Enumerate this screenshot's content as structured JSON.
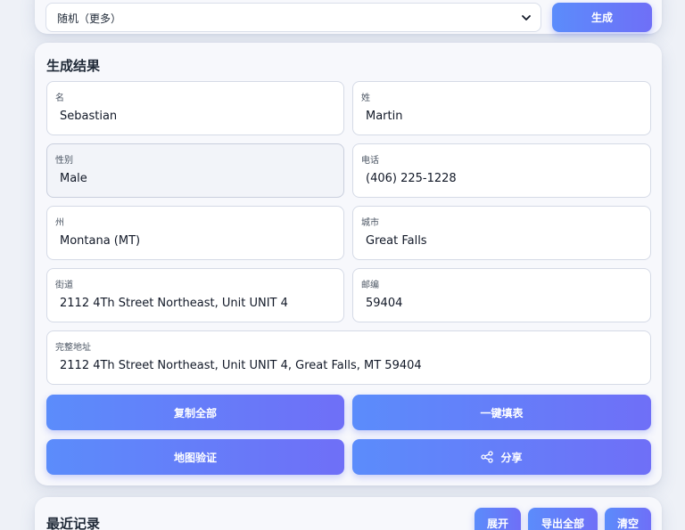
{
  "generator": {
    "select_value": "随机（更多）",
    "generate_label": "生成"
  },
  "result": {
    "title": "生成结果",
    "fields": {
      "first_name": {
        "label": "名",
        "value": "Sebastian"
      },
      "last_name": {
        "label": "姓",
        "value": "Martin"
      },
      "gender": {
        "label": "性别",
        "value": "Male"
      },
      "phone": {
        "label": "电话",
        "value": "(406) 225-1228"
      },
      "state": {
        "label": "州",
        "value": "Montana (MT)"
      },
      "city": {
        "label": "城市",
        "value": "Great Falls"
      },
      "street": {
        "label": "街道",
        "value": "2112 4Th Street Northeast, Unit UNIT 4"
      },
      "zip": {
        "label": "邮编",
        "value": "59404"
      },
      "full_address": {
        "label": "完整地址",
        "value": "2112 4Th Street Northeast, Unit UNIT 4, Great Falls, MT 59404"
      }
    },
    "actions": {
      "copy_all": "复制全部",
      "autofill": "一键填表",
      "map_verify": "地图验证",
      "share": "分享"
    }
  },
  "recent": {
    "title": "最近记录",
    "expand": "展开",
    "export_all": "导出全部",
    "clear": "清空"
  },
  "colors": {
    "accent_start": "#5b8cfb",
    "accent_end": "#6f6ff7",
    "background": "#eef1f7"
  },
  "icons": {
    "select_arrow": "chevron-down-icon",
    "share": "share-icon"
  }
}
